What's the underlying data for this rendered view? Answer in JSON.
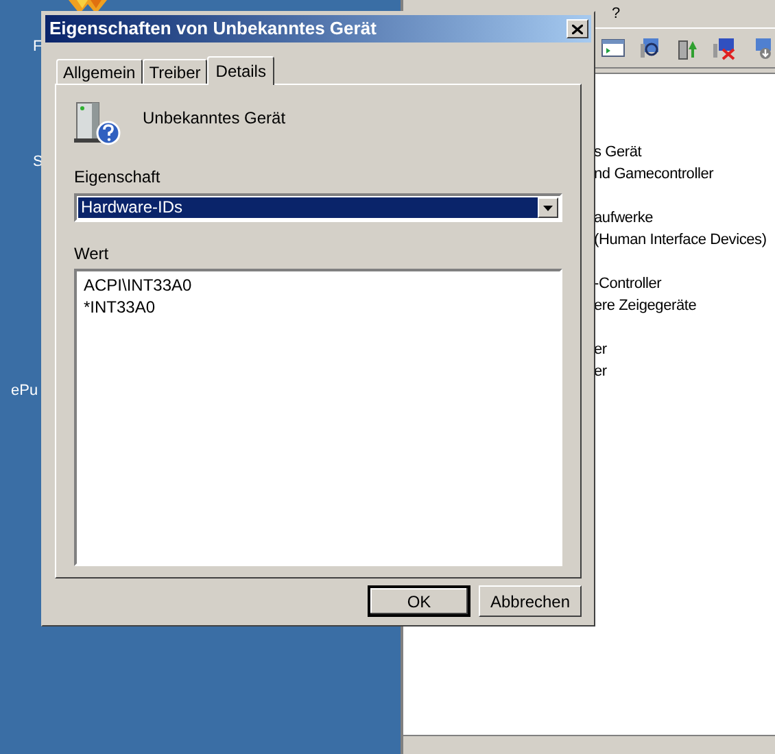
{
  "desktop": {
    "icon_labels": [
      "F",
      "S",
      "ePu"
    ]
  },
  "background_window": {
    "menu": [
      "?"
    ],
    "device_list": [
      "s Gerät",
      "nd Gamecontroller",
      "aufwerke",
      "(Human Interface Devices)",
      "-Controller",
      "ere Zeigegeräte",
      "er",
      "er"
    ]
  },
  "dialog": {
    "title": "Eigenschaften von Unbekanntes Gerät",
    "tabs": [
      {
        "label": "Allgemein",
        "selected": false
      },
      {
        "label": "Treiber",
        "selected": false
      },
      {
        "label": "Details",
        "selected": true
      }
    ],
    "device_name": "Unbekanntes Gerät",
    "property": {
      "label": "Eigenschaft",
      "value": "Hardware-IDs"
    },
    "value": {
      "label": "Wert",
      "lines": [
        "ACPI\\INT33A0",
        "*INT33A0"
      ]
    },
    "buttons": [
      {
        "label": "OK",
        "default": true
      },
      {
        "label": "Abbrechen",
        "default": false
      }
    ]
  }
}
